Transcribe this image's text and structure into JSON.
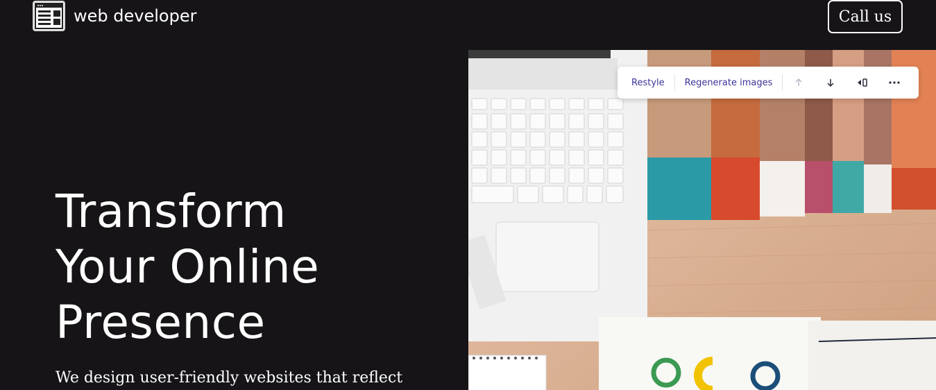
{
  "header": {
    "brand_name": "web developer",
    "call_button_label": "Call us"
  },
  "hero": {
    "headline_line1": "Transform",
    "headline_line2": "Your Online",
    "headline_line3": "Presence",
    "subtext": "We design user-friendly websites that reflect"
  },
  "toolbar": {
    "restyle_label": "Restyle",
    "regenerate_label": "Regenerate images",
    "icons": [
      "arrow-up-icon",
      "arrow-down-icon",
      "volume-icon",
      "more-icon"
    ]
  },
  "colors": {
    "page_background": "#161417",
    "text": "#ffffff",
    "toolbar_text": "#3b3498",
    "toolbar_background": "#ffffff"
  }
}
